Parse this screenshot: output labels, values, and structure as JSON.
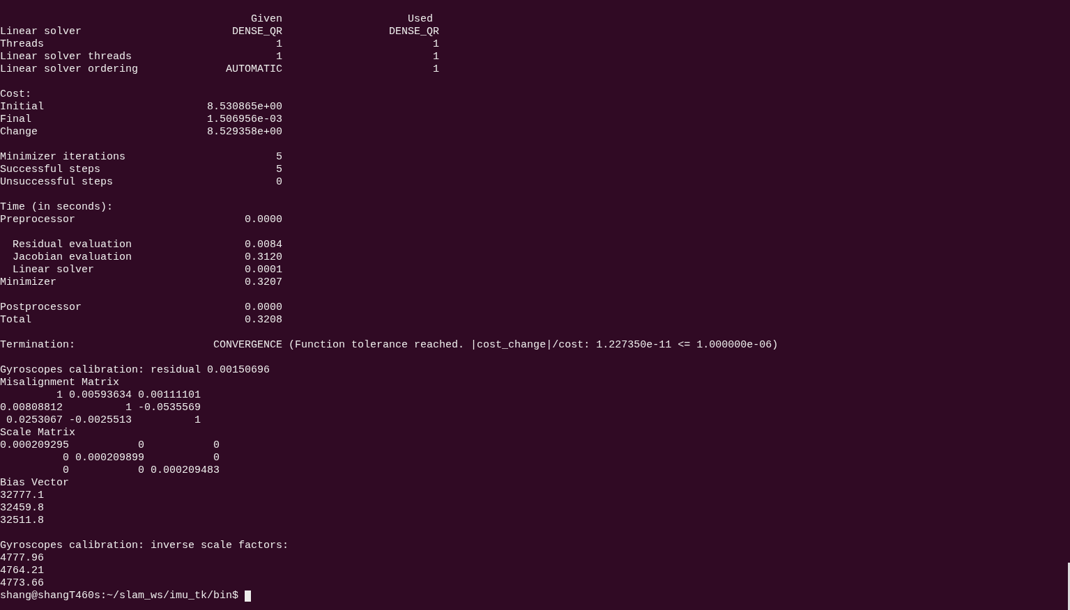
{
  "terminal": {
    "blocks": [
      [
        "                                        Given                    Used",
        "Linear solver                        DENSE_QR                 DENSE_QR",
        "Threads                                     1                        1",
        "Linear solver threads                       1                        1",
        "Linear solver ordering              AUTOMATIC                        1"
      ],
      [
        "Cost:",
        "Initial                          8.530865e+00",
        "Final                            1.506956e-03",
        "Change                           8.529358e+00"
      ],
      [
        "Minimizer iterations                        5",
        "Successful steps                            5",
        "Unsuccessful steps                          0"
      ],
      [
        "Time (in seconds):",
        "Preprocessor                           0.0000"
      ],
      [
        "  Residual evaluation                  0.0084",
        "  Jacobian evaluation                  0.3120",
        "  Linear solver                        0.0001",
        "Minimizer                              0.3207"
      ],
      [
        "Postprocessor                          0.0000",
        "Total                                  0.3208"
      ],
      [
        "Termination:                      CONVERGENCE (Function tolerance reached. |cost_change|/cost: 1.227350e-11 <= 1.000000e-06)"
      ],
      [
        "Gyroscopes calibration: residual 0.00150696",
        "Misalignment Matrix",
        "         1 0.00593634 0.00111101",
        "0.00808812          1 -0.0535569",
        " 0.0253067 -0.0025513          1",
        "Scale Matrix",
        "0.000209295           0           0",
        "          0 0.000209899           0",
        "          0           0 0.000209483",
        "Bias Vector",
        "32777.1",
        "32459.8",
        "32511.8"
      ],
      [
        "Gyroscopes calibration: inverse scale factors:",
        "4777.96",
        "4764.21",
        "4773.66"
      ]
    ],
    "prompt": "shang@shangT460s:~/slam_ws/imu_tk/bin$ ",
    "cursor_visible": true
  }
}
